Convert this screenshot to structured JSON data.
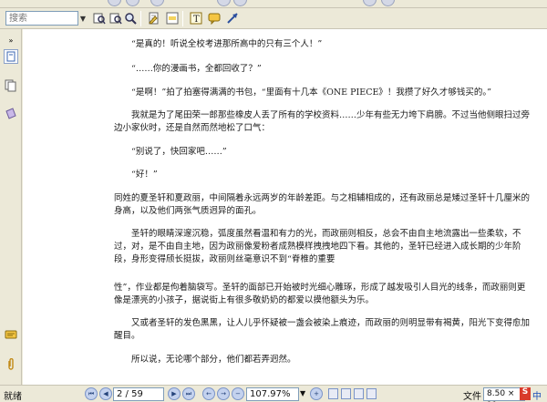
{
  "toolbar": {
    "search_placeholder": "搜索"
  },
  "page": {
    "paragraphs": [
      "“是真的！听说全校考进那所高中的只有三个人！”",
      "“……你的漫画书，全都回收了？”",
      "“是啊！”拍了拍塞得满满的书包，“里面有十几本《ONE PIECE》！我攒了好久才够钱买的。”",
      "我就是为了尾田荣一郎那些橡皮人丢了所有的学校资料……少年有些无力垮下肩膀。不过当他侧眼扫过旁边小家伙时，还是自然而然地松了口气：",
      "“别说了，快回家吧……”",
      "“好！”",
      "同姓的夏圣轩和夏政丽，中间隔着永远两岁的年龄差距。与之相辅相成的，还有政丽总是矮过圣轩十几厘米的身高，以及他们两张气质迥异的面孔。",
      "圣轩的眼睛深邃沉稳，弧度虽然看温和有力的光，而政丽则相反，总会不由自主地流露出一些柔软，不过，对，是不由自主地，因为政丽像爱粉者成熟模样拽拽地四下看。其他的，圣轩已经进入成长期的少年阶段，身形变得颀长挺拔，政丽则丝毫意识不到“脊椎的重要",
      "性”，作业都是佝着脑袋写。圣轩的面部已开始被时光细心雕琢，形成了越发吸引人目光的线条，而政丽则更像是漂亮的小孩子，据说街上有很多敬奶奶的都爱以摸他额头为乐。",
      "又或者圣轩的发色黑黑，让人儿乎怀疑被一盏会被染上痕迹，而政丽的则明显带有褐黄，阳光下变得愈加醒目。",
      "所以说，无论哪个部分，他们都若弄迥然。"
    ]
  },
  "status": {
    "ready": "就绪",
    "page_indicator": "2 / 59",
    "zoom": "107.97%",
    "file_label": "文件",
    "page_size": "8.50 × 11",
    "ime_badge": "S",
    "ime_lang": "中"
  }
}
